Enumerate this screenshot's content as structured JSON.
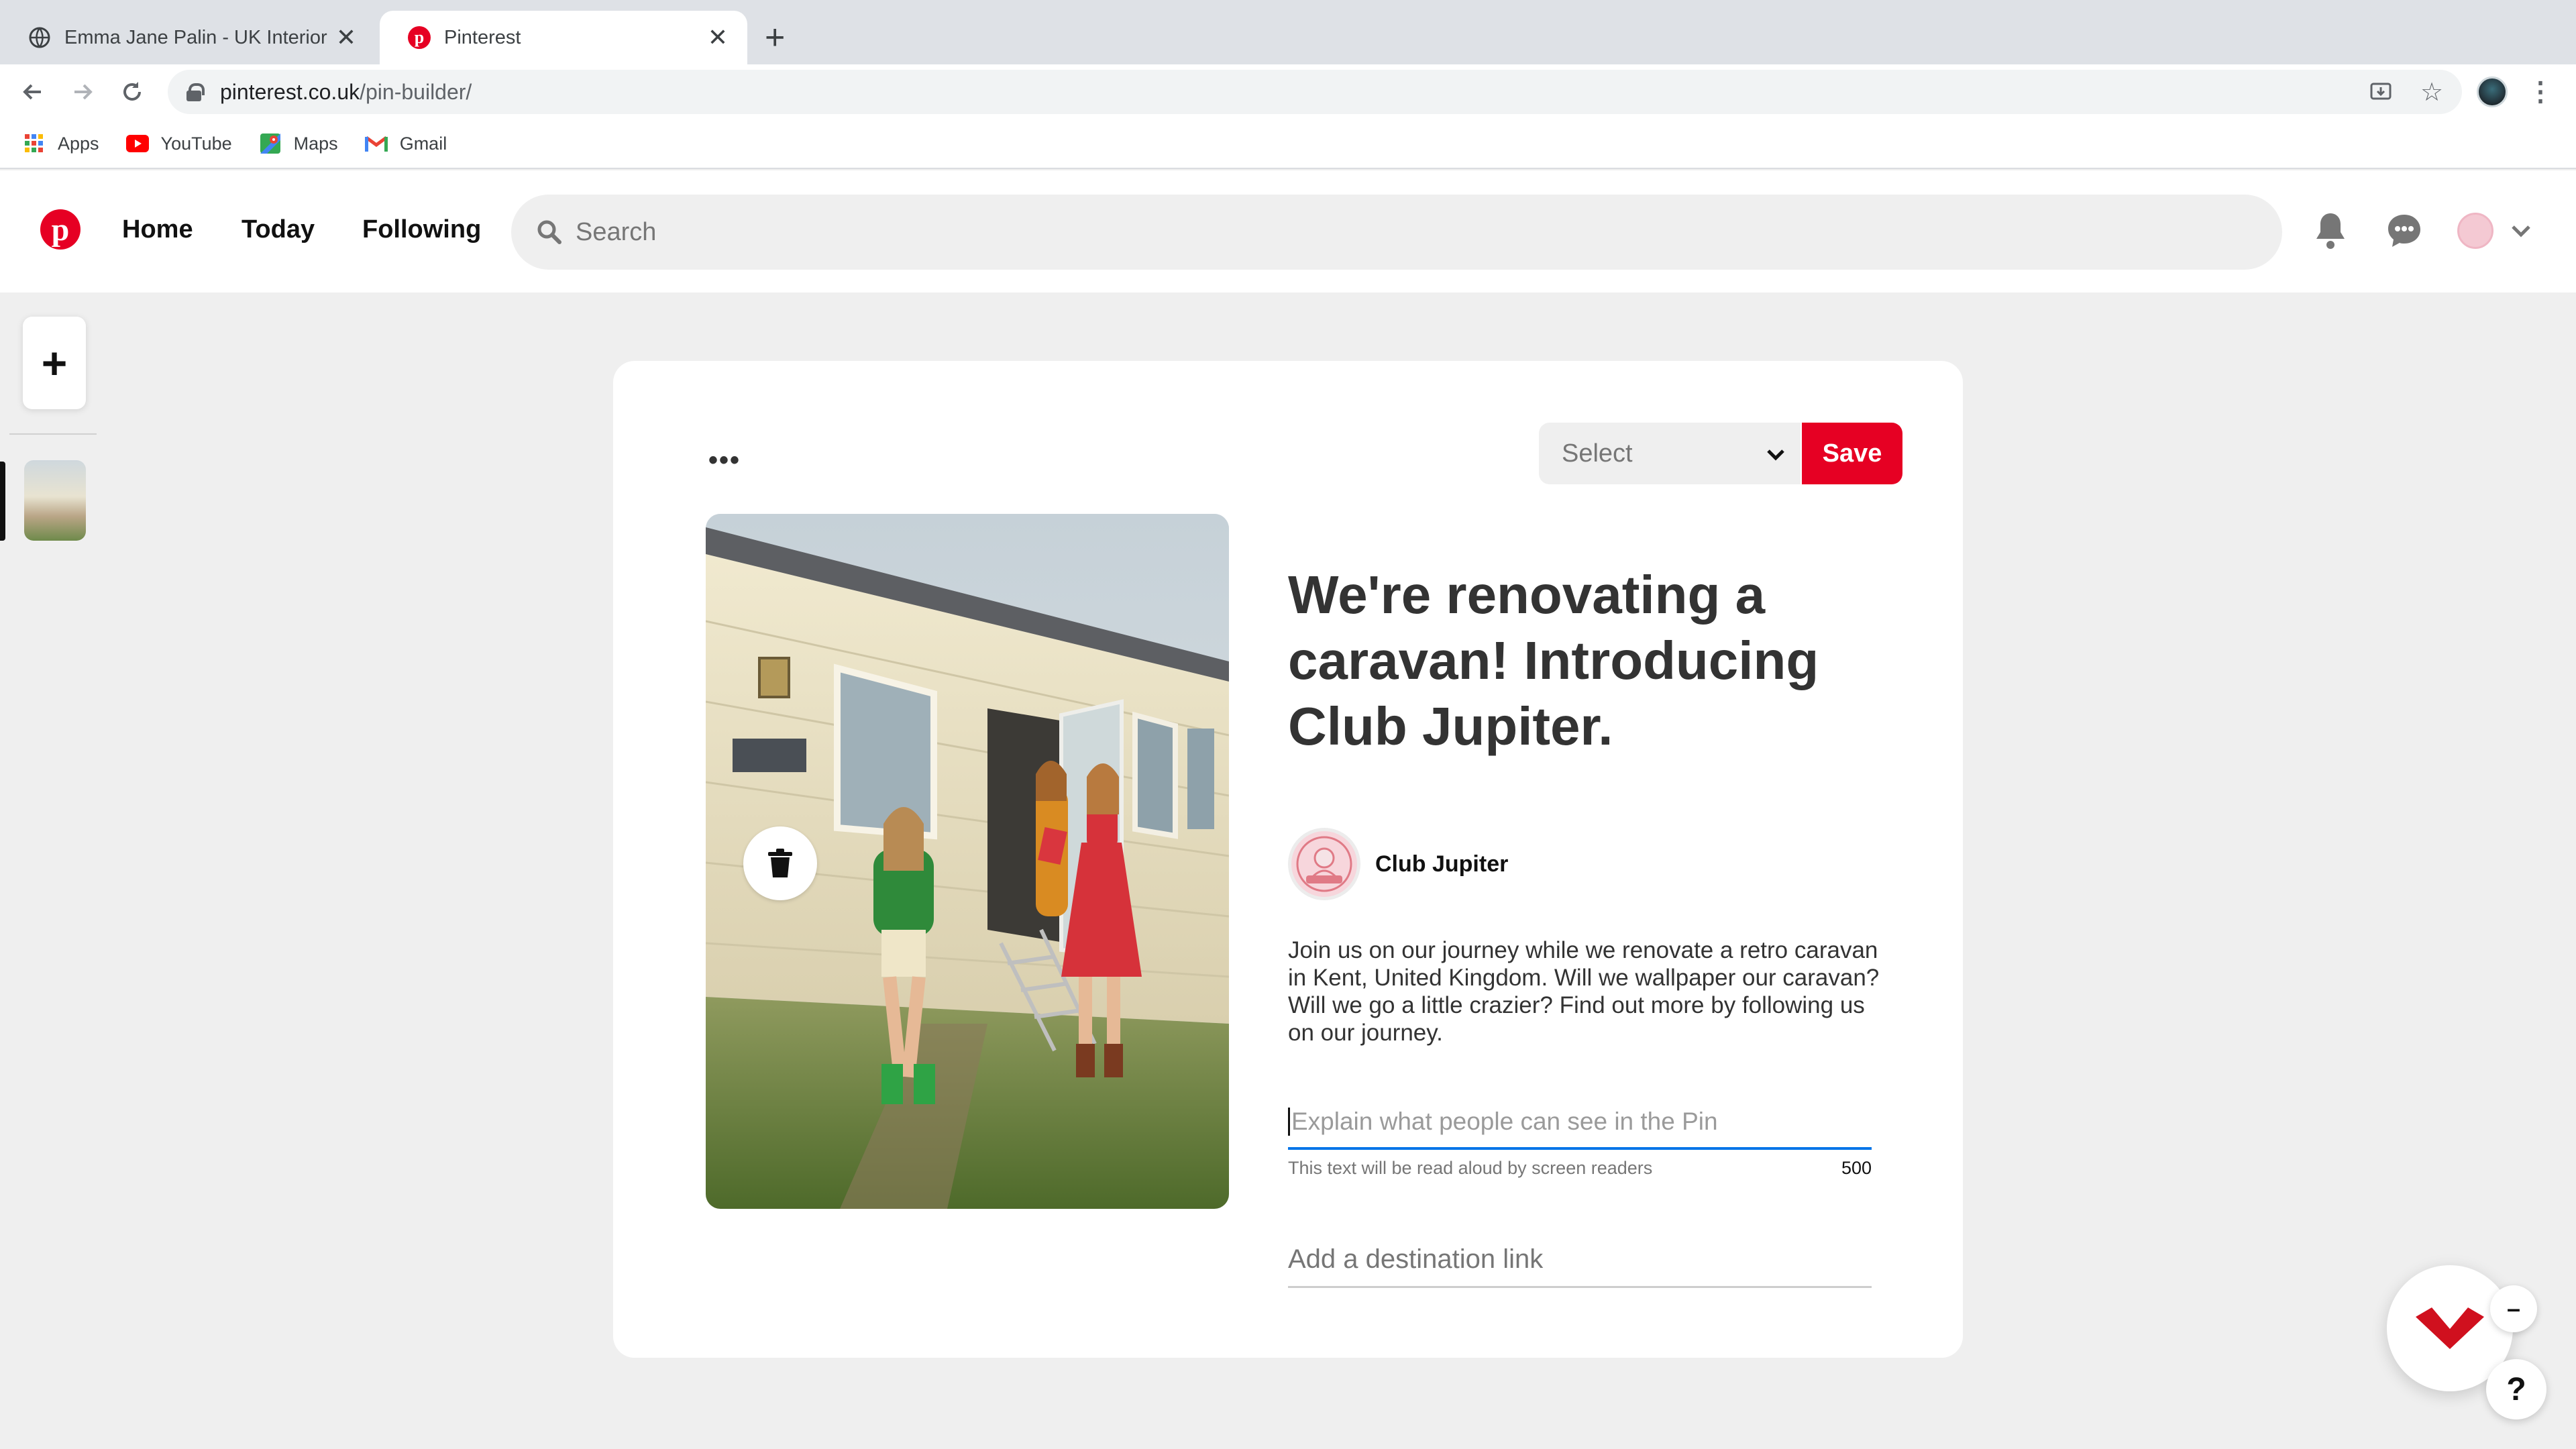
{
  "browser": {
    "tabs": [
      {
        "title": "Emma Jane Palin - UK Interior",
        "active": false
      },
      {
        "title": "Pinterest",
        "active": true
      }
    ],
    "url": {
      "host": "pinterest.co.uk",
      "path": "/pin-builder/"
    },
    "bookmarks": [
      {
        "label": "Apps",
        "icon": "apps-grid-icon"
      },
      {
        "label": "YouTube",
        "icon": "youtube-icon"
      },
      {
        "label": "Maps",
        "icon": "maps-icon"
      },
      {
        "label": "Gmail",
        "icon": "gmail-icon"
      }
    ]
  },
  "pinterest": {
    "brand_color": "#e60023",
    "nav": {
      "home": "Home",
      "today": "Today",
      "following": "Following"
    },
    "search": {
      "placeholder": "Search"
    }
  },
  "builder": {
    "board_select": {
      "value": "Select"
    },
    "save_label": "Save",
    "title": "We're renovating a caravan! Introducing Club Jupiter.",
    "author": {
      "name": "Club Jupiter"
    },
    "description": "Join us on our journey while we renovate a retro caravan in Kent, United Kingdom. Will we wallpaper our caravan? Will we go a little crazier? Find out more by following us on our journey.",
    "alt_text": {
      "placeholder": "Explain what people can see in the Pin",
      "help": "This text will be read aloud by screen readers",
      "remaining": "500"
    },
    "link": {
      "placeholder": "Add a destination link"
    }
  },
  "widgets": {
    "help_label": "?"
  }
}
